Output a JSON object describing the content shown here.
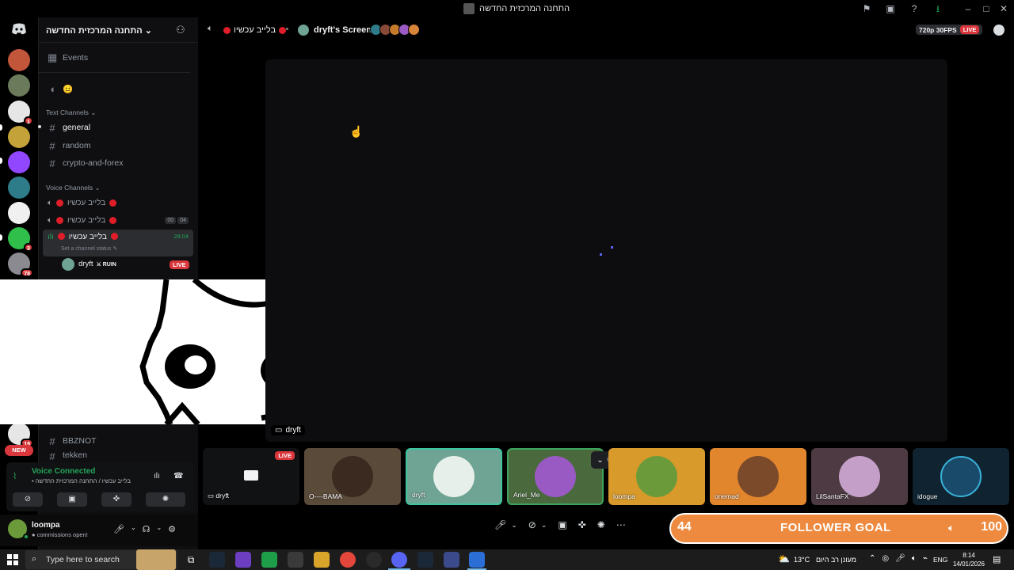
{
  "window": {
    "title": "התחנה המרכזית החדשה"
  },
  "server": {
    "name": "התחנה המרכזית החדשה"
  },
  "rail": {
    "badges": [
      "1",
      "3",
      "78",
      "19"
    ],
    "new_label": "NEW"
  },
  "sidebar": {
    "events_label": "Events",
    "emoji_row": "😐",
    "text_category": "Text Channels",
    "text_channels": [
      "general",
      "random",
      "crypto-and-forex"
    ],
    "voice_category": "Voice Channels",
    "voice_channels": [
      {
        "name": "בלייב עכשיו"
      },
      {
        "name": "בלייב עכשיו",
        "count_a": "00",
        "count_b": "04"
      },
      {
        "name": "בלייב עכשיו",
        "timer": "28:04",
        "status": "Set a channel status"
      }
    ],
    "voice_user": {
      "name": "dryft",
      "tag": "RUIN",
      "live": "LIVE"
    },
    "lower_channels": [
      "BBZNOT",
      "tekken"
    ]
  },
  "stage_header": {
    "channel": "בלייב עכשיו",
    "screen_owner": "dryft's Screen",
    "quality": "720p 30FPS",
    "live": "LIVE"
  },
  "stage": {
    "stream_label": "dryft"
  },
  "tiles": [
    {
      "name": "dryft",
      "live": "LIVE",
      "bg": "#111214"
    },
    {
      "name": "O----BAMA",
      "bg": "#5a4a3a"
    },
    {
      "name": "dryft",
      "bg": "#6fa393"
    },
    {
      "name": "Ariel_Me",
      "bg": "#4a6a3e"
    },
    {
      "name": "loompa",
      "bg": "#d89a2a"
    },
    {
      "name": "onemad",
      "bg": "#e2862e"
    },
    {
      "name": "LilSantaFX",
      "bg": "#4d3a42"
    },
    {
      "name": "idogue",
      "bg": "#0f2430"
    }
  ],
  "voice_panel": {
    "status": "Voice Connected",
    "channel": "בלייב עכשיו / התחנה המרכזית החדשה"
  },
  "user_panel": {
    "username": "loompa",
    "status": "commissions open!"
  },
  "goal": {
    "count": "44",
    "label": "FOLLOWER GOAL",
    "target": "100"
  },
  "taskbar": {
    "search_placeholder": "Type here to search",
    "weather": "13°C",
    "weather_desc": "מעונן רב היום",
    "lang": "ENG",
    "time": "8:14",
    "date": "14/01/2026"
  },
  "colors": {
    "accent": "#5865f2",
    "live": "#da373c",
    "goal": "#ee8a3f",
    "connected": "#23a559"
  }
}
